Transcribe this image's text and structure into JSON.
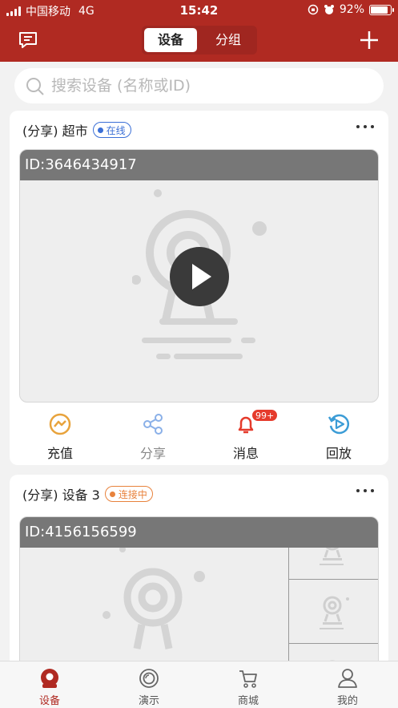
{
  "status_bar": {
    "carrier": "中国移动",
    "network": "4G",
    "time": "15:42",
    "battery_text": "92%",
    "battery_level": 0.92
  },
  "nav": {
    "tab_devices": "设备",
    "tab_groups": "分组"
  },
  "search": {
    "placeholder": "搜索设备 (名称或ID)"
  },
  "devices": [
    {
      "name": "(分享) 超市",
      "status": "在线",
      "id_label": "ID:3646434917",
      "actions": {
        "recharge": "充值",
        "share": "分享",
        "messages": "消息",
        "playback": "回放",
        "message_count": "99+"
      }
    },
    {
      "name": "(分享) 设备 3",
      "status": "连接中",
      "id_label": "ID:4156156599"
    }
  ],
  "tabbar": {
    "devices": "设备",
    "demo": "演示",
    "mall": "商城",
    "mine": "我的"
  },
  "colors": {
    "brand": "#b02a22",
    "online": "#3b6fd6",
    "connecting": "#e8823c",
    "badge": "#e53b2c"
  }
}
